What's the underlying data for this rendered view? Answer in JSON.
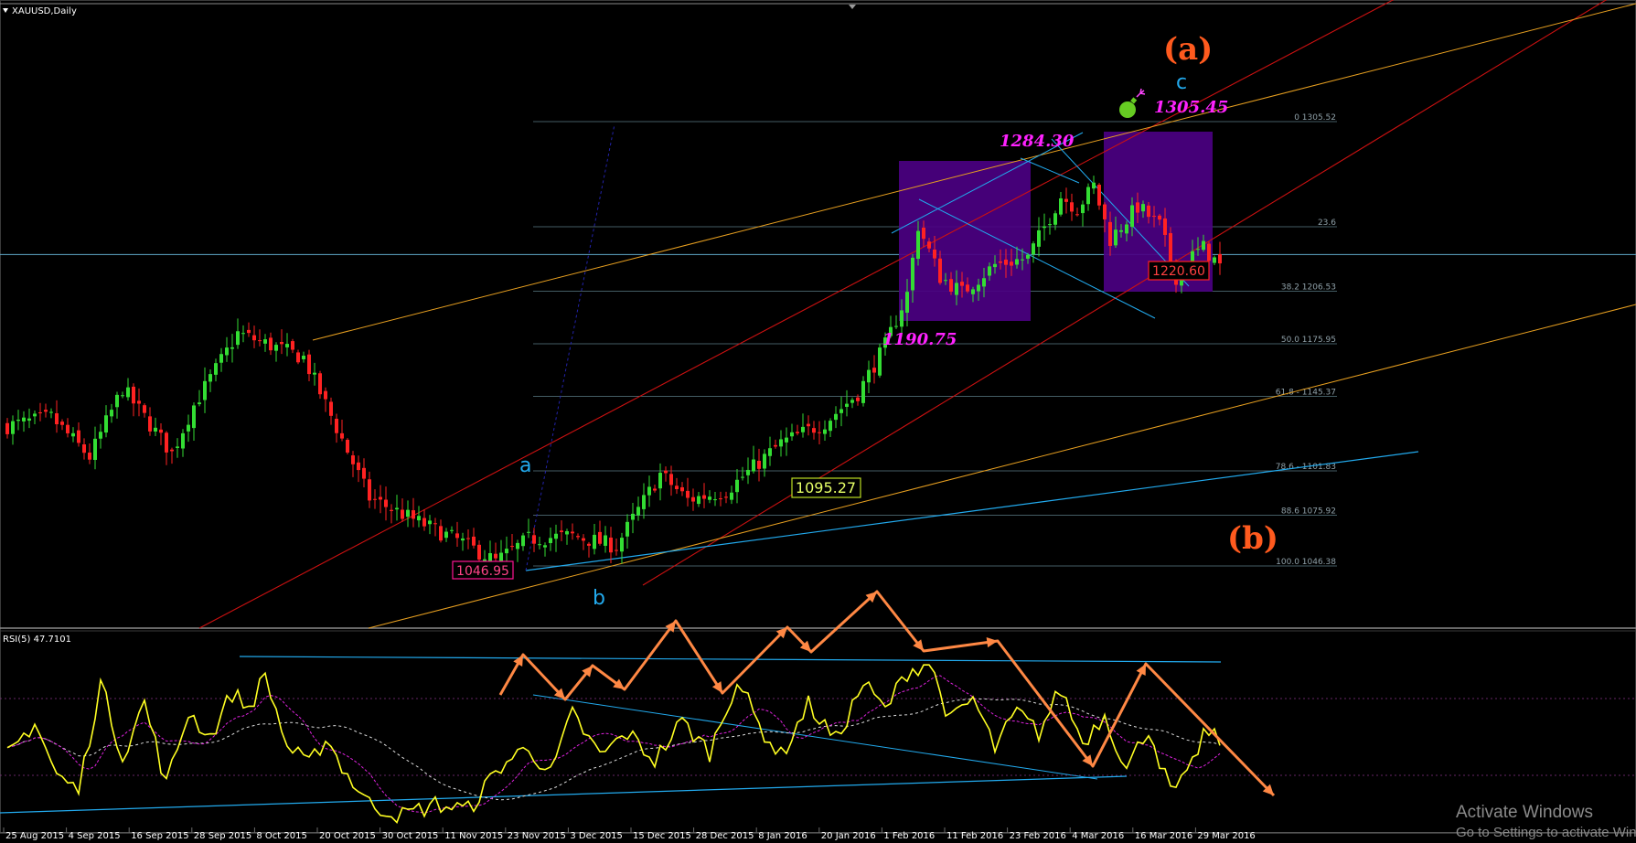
{
  "window": {
    "symbol_title": "XAUUSD,Daily",
    "rsi_title": "RSI(5) 47.7101"
  },
  "colors": {
    "background": "#000000",
    "bull": "#33dd33",
    "bear": "#ff2222",
    "channel_red": "#cc1111",
    "channel_orange": "#e8a020",
    "trend_blue": "#22aaee",
    "box_purple": "#4b0082",
    "magenta_label": "#ff22ff",
    "rsi_line": "#ffff22",
    "arrow": "#ff8844"
  },
  "chart_data": [
    {
      "type": "candlestick",
      "title": "XAUUSD,Daily",
      "x_tick_labels": [
        "25 Aug 2015",
        "4 Sep 2015",
        "16 Sep 2015",
        "28 Sep 2015",
        "8 Oct 2015",
        "20 Oct 2015",
        "30 Oct 2015",
        "11 Nov 2015",
        "23 Nov 2015",
        "3 Dec 2015",
        "15 Dec 2015",
        "28 Dec 2015",
        "8 Jan 2016",
        "20 Jan 2016",
        "1 Feb 2016",
        "11 Feb 2016",
        "23 Feb 2016",
        "4 Mar 2016",
        "16 Mar 2016",
        "29 Mar 2016"
      ],
      "ylim": [
        1010,
        1340
      ],
      "price_anchors": [
        {
          "i": 0,
          "p": 1128
        },
        {
          "i": 8,
          "p": 1133
        },
        {
          "i": 15,
          "p": 1110
        },
        {
          "i": 21,
          "p": 1150
        },
        {
          "i": 30,
          "p": 1112
        },
        {
          "i": 34,
          "p": 1140
        },
        {
          "i": 42,
          "p": 1182
        },
        {
          "i": 54,
          "p": 1168
        },
        {
          "i": 66,
          "p": 1086
        },
        {
          "i": 75,
          "p": 1072
        },
        {
          "i": 83,
          "p": 1060
        },
        {
          "i": 89,
          "p": 1049
        },
        {
          "i": 95,
          "p": 1062
        },
        {
          "i": 103,
          "p": 1064
        },
        {
          "i": 111,
          "p": 1058
        },
        {
          "i": 119,
          "p": 1100
        },
        {
          "i": 124,
          "p": 1085
        },
        {
          "i": 131,
          "p": 1090
        },
        {
          "i": 141,
          "p": 1118
        },
        {
          "i": 149,
          "p": 1130
        },
        {
          "i": 155,
          "p": 1147
        },
        {
          "i": 160,
          "p": 1175
        },
        {
          "i": 164,
          "p": 1205
        },
        {
          "i": 166,
          "p": 1245
        },
        {
          "i": 170,
          "p": 1215
        },
        {
          "i": 174,
          "p": 1206
        },
        {
          "i": 180,
          "p": 1222
        },
        {
          "i": 186,
          "p": 1226
        },
        {
          "i": 192,
          "p": 1262
        },
        {
          "i": 195,
          "p": 1255
        },
        {
          "i": 198,
          "p": 1268
        },
        {
          "i": 201,
          "p": 1237
        },
        {
          "i": 206,
          "p": 1256
        },
        {
          "i": 210,
          "p": 1245
        },
        {
          "i": 213,
          "p": 1215
        },
        {
          "i": 215,
          "p": 1225
        },
        {
          "i": 218,
          "p": 1232
        },
        {
          "i": 221,
          "p": 1221
        }
      ],
      "n_candles": 222,
      "fibonacci": [
        {
          "label": "0 1305.52",
          "price": 1305.52
        },
        {
          "label": "23.6",
          "price": 1244.2
        },
        {
          "label": "38.2 1206.53",
          "price": 1206.53
        },
        {
          "label": "50.0 1175.95",
          "price": 1175.95
        },
        {
          "label": "61.8 - 1145.37",
          "price": 1145.37
        },
        {
          "label": "78.6 - 1101.83",
          "price": 1101.83
        },
        {
          "label": "88.6 1075.92",
          "price": 1075.92
        },
        {
          "label": "100.0 1046.38",
          "price": 1046.38
        }
      ],
      "horizontal_line_price": 1228,
      "price_labels": [
        {
          "text": "1046.95",
          "style": "box-magenta"
        },
        {
          "text": "1095.27",
          "style": "box-olive"
        },
        {
          "text": "1220.60",
          "style": "box-red"
        }
      ],
      "magenta_labels": [
        "1284.30",
        "1190.75",
        "1305.45"
      ],
      "wave_labels": {
        "a": "a",
        "b": "b",
        "c": "c",
        "big_a": "(a)",
        "big_b": "(b)"
      }
    },
    {
      "type": "line",
      "title": "RSI(5) 47.7101",
      "ylim": [
        0,
        100
      ],
      "levels": [
        30,
        70
      ],
      "rsi_anchors": [
        {
          "i": 0,
          "v": 40
        },
        {
          "i": 5,
          "v": 58
        },
        {
          "i": 9,
          "v": 30
        },
        {
          "i": 13,
          "v": 22
        },
        {
          "i": 17,
          "v": 78
        },
        {
          "i": 21,
          "v": 40
        },
        {
          "i": 25,
          "v": 68
        },
        {
          "i": 29,
          "v": 25
        },
        {
          "i": 33,
          "v": 63
        },
        {
          "i": 37,
          "v": 50
        },
        {
          "i": 41,
          "v": 73
        },
        {
          "i": 44,
          "v": 65
        },
        {
          "i": 47,
          "v": 82
        },
        {
          "i": 51,
          "v": 45
        },
        {
          "i": 55,
          "v": 35
        },
        {
          "i": 58,
          "v": 50
        },
        {
          "i": 62,
          "v": 30
        },
        {
          "i": 66,
          "v": 15
        },
        {
          "i": 72,
          "v": 9
        },
        {
          "i": 78,
          "v": 15
        },
        {
          "i": 84,
          "v": 12
        },
        {
          "i": 90,
          "v": 35
        },
        {
          "i": 95,
          "v": 45
        },
        {
          "i": 99,
          "v": 30
        },
        {
          "i": 103,
          "v": 62
        },
        {
          "i": 108,
          "v": 40
        },
        {
          "i": 113,
          "v": 52
        },
        {
          "i": 118,
          "v": 38
        },
        {
          "i": 123,
          "v": 58
        },
        {
          "i": 128,
          "v": 42
        },
        {
          "i": 133,
          "v": 80
        },
        {
          "i": 137,
          "v": 56
        },
        {
          "i": 141,
          "v": 40
        },
        {
          "i": 146,
          "v": 67
        },
        {
          "i": 151,
          "v": 48
        },
        {
          "i": 156,
          "v": 78
        },
        {
          "i": 160,
          "v": 64
        },
        {
          "i": 164,
          "v": 84
        },
        {
          "i": 168,
          "v": 89
        },
        {
          "i": 172,
          "v": 58
        },
        {
          "i": 176,
          "v": 70
        },
        {
          "i": 180,
          "v": 44
        },
        {
          "i": 184,
          "v": 63
        },
        {
          "i": 188,
          "v": 52
        },
        {
          "i": 192,
          "v": 75
        },
        {
          "i": 196,
          "v": 47
        },
        {
          "i": 200,
          "v": 62
        },
        {
          "i": 204,
          "v": 33
        },
        {
          "i": 208,
          "v": 55
        },
        {
          "i": 212,
          "v": 21
        },
        {
          "i": 215,
          "v": 28
        },
        {
          "i": 218,
          "v": 52
        },
        {
          "i": 221,
          "v": 48
        }
      ]
    }
  ],
  "watermark": {
    "line1": "Activate Windows",
    "line2": "Go to Settings to activate Win"
  }
}
